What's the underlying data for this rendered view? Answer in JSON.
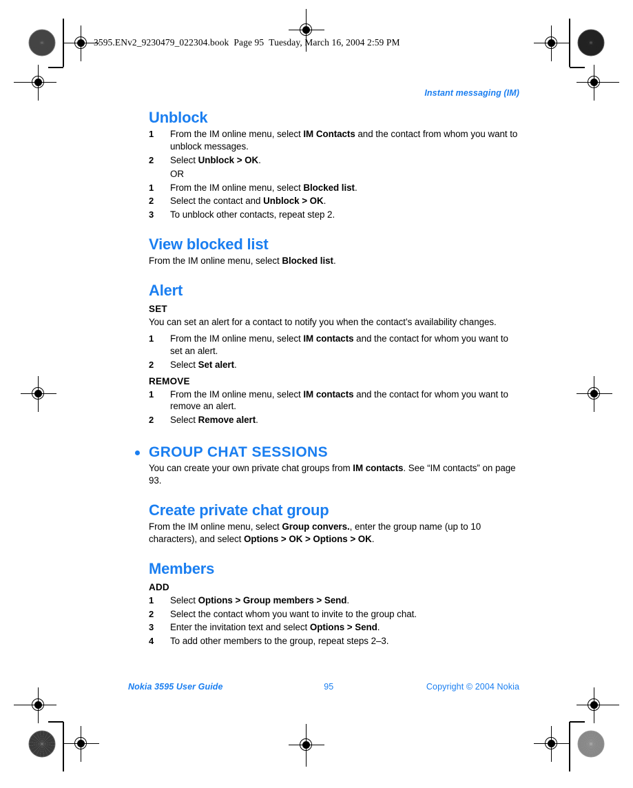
{
  "book_header": {
    "filename": "3595.ENv2_9230479_022304.book",
    "page_label": "Page 95",
    "timestamp": "Tuesday, March 16, 2004  2:59 PM"
  },
  "running_head": "Instant messaging (IM)",
  "colors": {
    "heading_blue": "#1a7ef0",
    "body_black": "#000000"
  },
  "sections": {
    "unblock": {
      "heading": "Unblock",
      "steps_a": [
        {
          "num": "1",
          "text_html": "From the IM online menu, select <b>IM Contacts</b> and the contact from whom you want to unblock messages."
        },
        {
          "num": "2",
          "text_html": "Select <b>Unblock &gt; OK</b>."
        }
      ],
      "or_label": "OR",
      "steps_b": [
        {
          "num": "1",
          "text_html": "From the IM online menu, select <b>Blocked list</b>."
        },
        {
          "num": "2",
          "text_html": "Select the contact and <b>Unblock &gt; OK</b>."
        },
        {
          "num": "3",
          "text_html": "To unblock other contacts, repeat step 2."
        }
      ]
    },
    "view_blocked_list": {
      "heading": "View blocked list",
      "body_html": "From the IM online menu, select <b>Blocked list</b>."
    },
    "alert": {
      "heading": "Alert",
      "set_label": "SET",
      "set_intro": "You can set an alert for a contact to notify you when the contact’s availability changes.",
      "set_steps": [
        {
          "num": "1",
          "text_html": "From the IM online menu, select <b>IM contacts</b> and the contact for whom you want to set an alert."
        },
        {
          "num": "2",
          "text_html": "Select <b>Set alert</b>."
        }
      ],
      "remove_label": "REMOVE",
      "remove_steps": [
        {
          "num": "1",
          "text_html": "From the IM online menu, select <b>IM contacts</b> and the contact for whom you want to remove an alert."
        },
        {
          "num": "2",
          "text_html": "Select <b>Remove alert</b>."
        }
      ]
    },
    "group_chat": {
      "heading": "GROUP CHAT SESSIONS",
      "intro_html": "You can create your own private chat groups from <b>IM contacts</b>. See “IM contacts” on page 93.",
      "create_group": {
        "heading": "Create private chat group",
        "body_html": "From the IM online menu, select <b>Group convers.</b>, enter the group name (up to 10 characters), and select <b>Options &gt; OK &gt; Options &gt; OK</b>."
      },
      "members": {
        "heading": "Members",
        "add_label": "ADD",
        "add_steps": [
          {
            "num": "1",
            "text_html": "Select <b>Options &gt; Group members &gt; Send</b>."
          },
          {
            "num": "2",
            "text_html": "Select the contact whom you want to invite to the group chat."
          },
          {
            "num": "3",
            "text_html": "Enter the invitation text and select <b>Options &gt; Send</b>."
          },
          {
            "num": "4",
            "text_html": "To add other members to the group, repeat steps 2–3."
          }
        ]
      }
    }
  },
  "footer": {
    "left": "Nokia 3595 User Guide",
    "page_number": "95",
    "right": "Copyright © 2004 Nokia"
  }
}
